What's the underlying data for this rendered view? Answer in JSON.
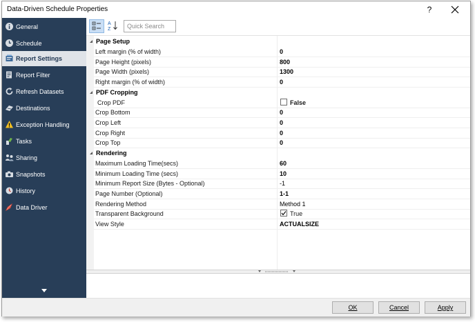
{
  "window": {
    "title": "Data-Driven Schedule Properties",
    "help_label": "?"
  },
  "sidebar": {
    "items": [
      {
        "label": "General",
        "icon": "info-icon"
      },
      {
        "label": "Schedule",
        "icon": "clock-icon"
      },
      {
        "label": "Report Settings",
        "icon": "report-settings-icon",
        "active": true
      },
      {
        "label": "Report Filter",
        "icon": "report-filter-icon"
      },
      {
        "label": "Refresh Datasets",
        "icon": "refresh-icon"
      },
      {
        "label": "Destinations",
        "icon": "destinations-icon"
      },
      {
        "label": "Exception Handling",
        "icon": "warning-icon"
      },
      {
        "label": "Tasks",
        "icon": "tasks-icon"
      },
      {
        "label": "Sharing",
        "icon": "sharing-icon"
      },
      {
        "label": "Snapshots",
        "icon": "camera-icon"
      },
      {
        "label": "History",
        "icon": "history-icon"
      },
      {
        "label": "Data Driver",
        "icon": "data-driver-icon"
      }
    ]
  },
  "toolbar": {
    "search_placeholder": "Quick Search",
    "sort_icon_text": "A Z"
  },
  "properties": {
    "page_setup": {
      "label": "Page Setup",
      "left_margin": {
        "name": "Left margin (% of width)",
        "value": "0"
      },
      "page_height": {
        "name": "Page Height (pixels)",
        "value": "800"
      },
      "page_width": {
        "name": "Page Width (pixels)",
        "value": "1300"
      },
      "right_margin": {
        "name": "Right margin (% of width)",
        "value": "0"
      }
    },
    "pdf_cropping": {
      "label": "PDF Cropping",
      "crop_pdf": {
        "name": "Crop PDF",
        "value": "False",
        "checked": false
      },
      "crop_bottom": {
        "name": "Crop Bottom",
        "value": "0"
      },
      "crop_left": {
        "name": "Crop Left",
        "value": "0"
      },
      "crop_right": {
        "name": "Crop Right",
        "value": "0"
      },
      "crop_top": {
        "name": "Crop Top",
        "value": "0"
      }
    },
    "rendering": {
      "label": "Rendering",
      "max_loading_time": {
        "name": "Maximum Loading Time(secs)",
        "value": "60"
      },
      "min_loading_time": {
        "name": "Minimum Loading Time (secs)",
        "value": "10"
      },
      "min_report_size": {
        "name": "Minimum Report Size (Bytes - Optional)",
        "value": "-1"
      },
      "page_number": {
        "name": "Page Number (Optional)",
        "value": "1-1"
      },
      "rendering_method": {
        "name": "Rendering Method",
        "value": "Method 1"
      },
      "transparent_background": {
        "name": "Transparent Background",
        "value": "True",
        "checked": true
      },
      "view_style": {
        "name": "View Style",
        "value": "ACTUALSIZE"
      }
    }
  },
  "buttons": {
    "ok": "OK",
    "cancel": "Cancel",
    "apply": "Apply"
  },
  "colors": {
    "sidebar_bg": "#283e58",
    "sidebar_active_bg": "#dfe3e8",
    "toolbar_toggle_bg": "#c9def5"
  }
}
